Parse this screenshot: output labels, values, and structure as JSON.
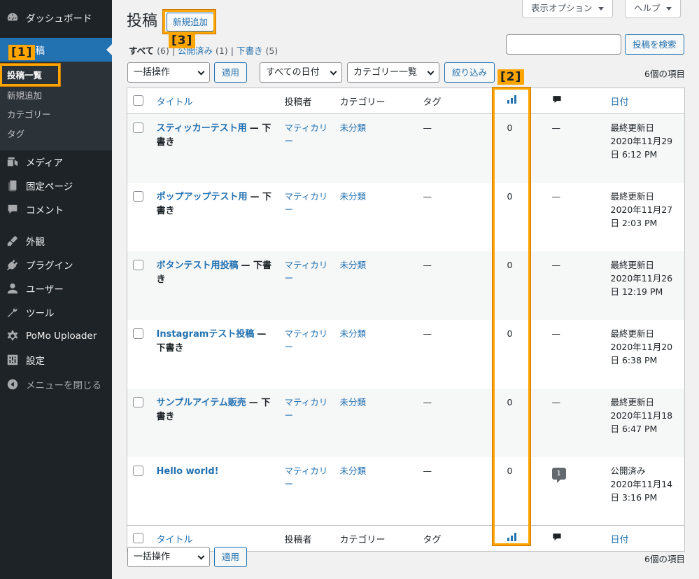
{
  "sidebar": {
    "items": [
      {
        "label": "ダッシュボード",
        "icon": "dashboard-icon"
      },
      {
        "label": "投稿",
        "icon": "pin-icon"
      },
      {
        "label": "メディア",
        "icon": "media-icon"
      },
      {
        "label": "固定ページ",
        "icon": "page-icon"
      },
      {
        "label": "コメント",
        "icon": "comment-icon"
      },
      {
        "label": "外観",
        "icon": "brush-icon"
      },
      {
        "label": "プラグイン",
        "icon": "plugin-icon"
      },
      {
        "label": "ユーザー",
        "icon": "user-icon"
      },
      {
        "label": "ツール",
        "icon": "wrench-icon"
      },
      {
        "label": "PoMo Uploader",
        "icon": "gear-icon"
      },
      {
        "label": "設定",
        "icon": "settings-icon"
      },
      {
        "label": "メニューを閉じる",
        "icon": "collapse-icon"
      }
    ],
    "submenu": [
      "投稿一覧",
      "新規追加",
      "カテゴリー",
      "タグ"
    ]
  },
  "header": {
    "title": "投稿",
    "add_new": "新規追加",
    "screen_options": "表示オプション",
    "help": "ヘルプ"
  },
  "filters": {
    "all": "すべて",
    "all_count": "(6)",
    "sep": "|",
    "published": "公開済み",
    "published_count": "(1)",
    "drafts": "下書き",
    "drafts_count": "(5)"
  },
  "search": {
    "button": "投稿を検索",
    "value": ""
  },
  "toolbar": {
    "bulk_actions": "一括操作",
    "apply": "適用",
    "all_dates": "すべての日付",
    "category_list": "カテゴリー一覧",
    "filter": "絞り込み",
    "items_count": "6個の項目"
  },
  "table": {
    "columns": {
      "title": "タイトル",
      "author": "投稿者",
      "categories": "カテゴリー",
      "tags": "タグ",
      "date": "日付"
    },
    "rows": [
      {
        "title": "スティッカーテスト用",
        "state": "— 下書き",
        "author": "マティカリー",
        "category": "未分類",
        "tags": "—",
        "views": "0",
        "comments": "—",
        "date_status": "最終更新日",
        "date_value": "2020年11月29日 6:12 PM"
      },
      {
        "title": "ポップアップテスト用",
        "state": "— 下書き",
        "author": "マティカリー",
        "category": "未分類",
        "tags": "—",
        "views": "0",
        "comments": "—",
        "date_status": "最終更新日",
        "date_value": "2020年11月27日 2:03 PM"
      },
      {
        "title": "ボタンテスト用投稿",
        "state": "— 下書き",
        "author": "マティカリー",
        "category": "未分類",
        "tags": "—",
        "views": "0",
        "comments": "—",
        "date_status": "最終更新日",
        "date_value": "2020年11月26日 12:19 PM"
      },
      {
        "title": "Instagramテスト投稿",
        "state": "— 下書き",
        "author": "マティカリー",
        "category": "未分類",
        "tags": "—",
        "views": "0",
        "comments": "—",
        "date_status": "最終更新日",
        "date_value": "2020年11月20日 6:38 PM"
      },
      {
        "title": "サンプルアイテム販売",
        "state": "— 下書き",
        "author": "マティカリー",
        "category": "未分類",
        "tags": "—",
        "views": "0",
        "comments": "—",
        "date_status": "最終更新日",
        "date_value": "2020年11月18日 6:47 PM"
      },
      {
        "title": "Hello world!",
        "state": "",
        "author": "マティカリー",
        "category": "未分類",
        "tags": "—",
        "views": "0",
        "comments": "1",
        "date_status": "公開済み",
        "date_value": "2020年11月14日 3:16 PM"
      }
    ]
  },
  "annotations": {
    "a1": "[1]",
    "a2": "[2]",
    "a3": "[3]"
  },
  "colors": {
    "accent": "#2271b1",
    "sidebar": "#1d2327",
    "highlight": "#ffa500"
  }
}
